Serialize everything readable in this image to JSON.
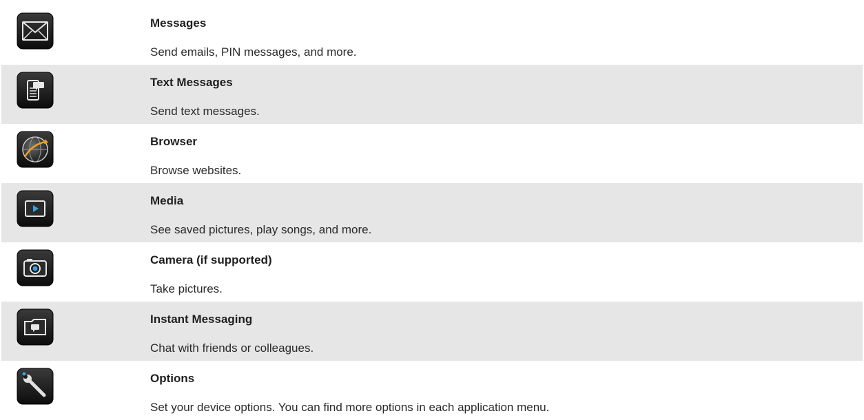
{
  "apps": [
    {
      "icon": "envelope-icon",
      "name": "Messages",
      "description": "Send emails, PIN messages, and more."
    },
    {
      "icon": "text-message-phone-icon",
      "name": "Text Messages",
      "description": "Send text messages."
    },
    {
      "icon": "globe-icon",
      "name": "Browser",
      "description": "Browse websites."
    },
    {
      "icon": "media-play-icon",
      "name": "Media",
      "description": "See saved pictures, play songs, and more."
    },
    {
      "icon": "camera-icon",
      "name": "Camera (if supported)",
      "description": "Take pictures."
    },
    {
      "icon": "chat-folder-icon",
      "name": "Instant Messaging",
      "description": "Chat with friends or colleagues."
    },
    {
      "icon": "wrench-icon",
      "name": "Options",
      "description": "Set your device options. You can find more options in each application menu."
    }
  ],
  "colors": {
    "row_shaded": "#e6e6e6",
    "row_plain": "#ffffff",
    "icon_bg": "#1a1a1a",
    "accent_blue": "#3aa0e0",
    "accent_orange": "#f0a020"
  }
}
